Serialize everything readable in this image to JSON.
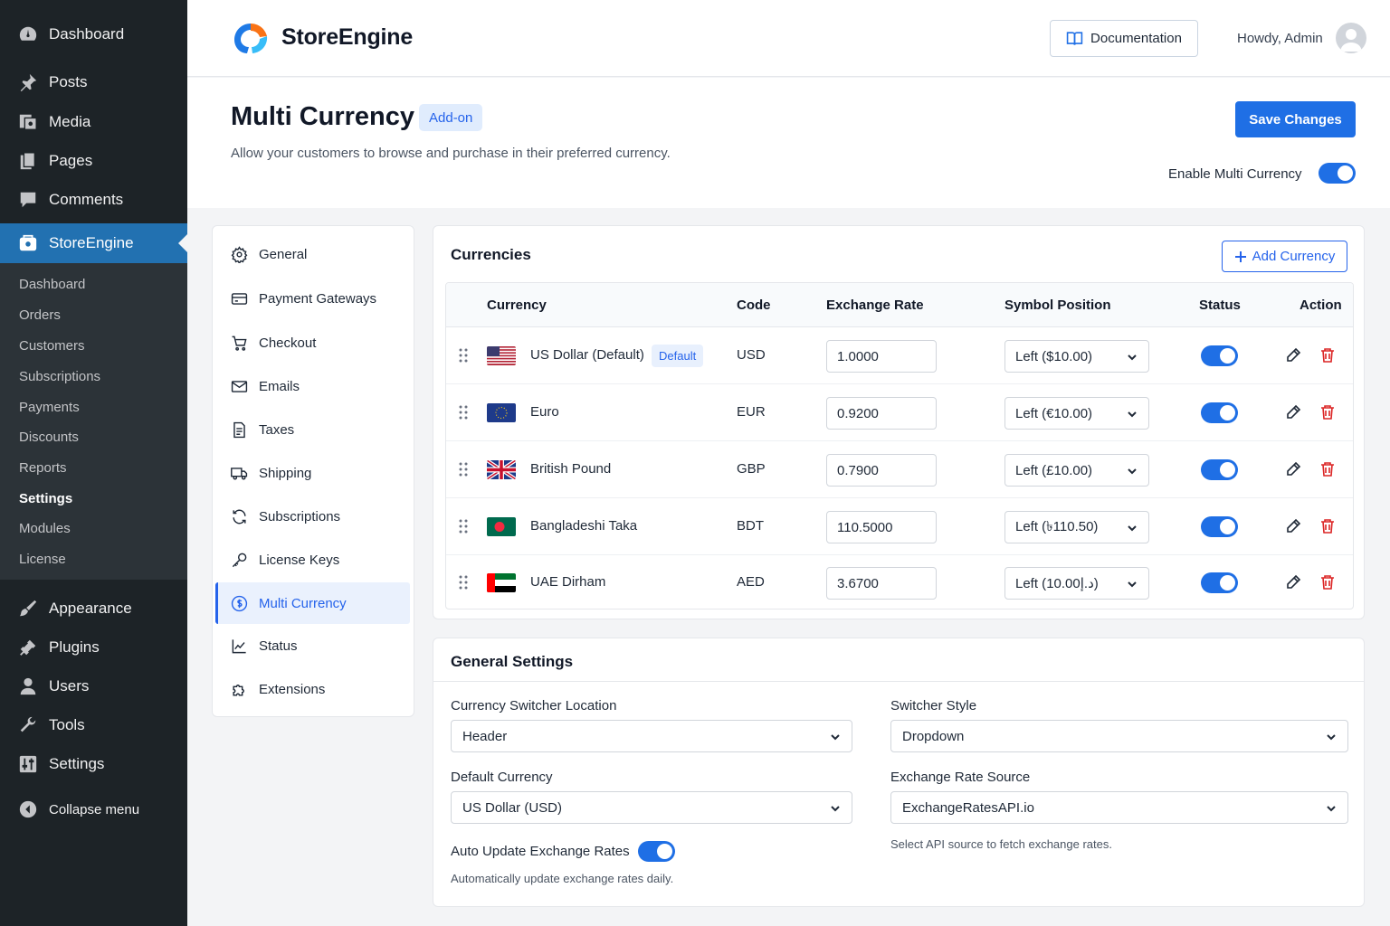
{
  "wp_menu": {
    "dashboard": "Dashboard",
    "posts": "Posts",
    "media": "Media",
    "pages": "Pages",
    "comments": "Comments",
    "storeengine": "StoreEngine",
    "submenu": [
      "Dashboard",
      "Orders",
      "Customers",
      "Subscriptions",
      "Payments",
      "Discounts",
      "Reports",
      "Settings",
      "Modules",
      "License"
    ],
    "submenu_current": "Settings",
    "appearance": "Appearance",
    "plugins": "Plugins",
    "users": "Users",
    "tools": "Tools",
    "settings": "Settings",
    "collapse": "Collapse menu"
  },
  "topbar": {
    "brand": "StoreEngine",
    "documentation": "Documentation",
    "howdy": "Howdy, Admin"
  },
  "page": {
    "title": "Multi Currency",
    "badge": "Add-on",
    "description": "Allow your customers to browse and purchase in their preferred currency.",
    "save_label": "Save Changes",
    "enable_label": "Enable Multi Currency",
    "enabled": true
  },
  "settings_nav": {
    "items": [
      "General",
      "Payment Gateways",
      "Checkout",
      "Emails",
      "Taxes",
      "Shipping",
      "Subscriptions",
      "License Keys",
      "Multi Currency",
      "Status",
      "Extensions"
    ],
    "active": "Multi Currency"
  },
  "currencies": {
    "title": "Currencies",
    "add_label": "Add Currency",
    "headers": {
      "currency": "Currency",
      "code": "Code",
      "rate": "Exchange Rate",
      "position": "Symbol Position",
      "status": "Status",
      "action": "Action"
    },
    "rows": [
      {
        "name": "US Dollar (Default)",
        "badge": "Default",
        "code": "USD",
        "rate": "1.0000",
        "position": "Left ($10.00)",
        "enabled": true
      },
      {
        "name": "Euro",
        "code": "EUR",
        "rate": "0.9200",
        "position": "Left (€10.00)",
        "enabled": true
      },
      {
        "name": "British Pound",
        "code": "GBP",
        "rate": "0.7900",
        "position": "Left (£10.00)",
        "enabled": true
      },
      {
        "name": "Bangladeshi Taka",
        "code": "BDT",
        "rate": "110.5000",
        "position": "Left (৳110.50)",
        "enabled": true
      },
      {
        "name": "UAE Dirham",
        "code": "AED",
        "rate": "3.6700",
        "position": "Left (د.إ10.00)",
        "enabled": true
      }
    ]
  },
  "general_settings": {
    "title": "General Settings",
    "switcher_location_label": "Currency Switcher Location",
    "switcher_location_value": "Header",
    "switcher_style_label": "Switcher Style",
    "switcher_style_value": "Dropdown",
    "default_currency_label": "Default Currency",
    "default_currency_value": "US Dollar (USD)",
    "rate_source_label": "Exchange Rate Source",
    "rate_source_value": "ExchangeRatesAPI.io",
    "rate_source_hint": "Select API source to fetch exchange rates.",
    "auto_update_label": "Auto Update Exchange Rates",
    "auto_update_enabled": true,
    "auto_update_hint": "Automatically update exchange rates daily."
  },
  "colors": {
    "accent": "#1f6fe5",
    "wp_sidebar": "#1d2327",
    "wp_active": "#2271b1",
    "delete": "#dc2626"
  }
}
